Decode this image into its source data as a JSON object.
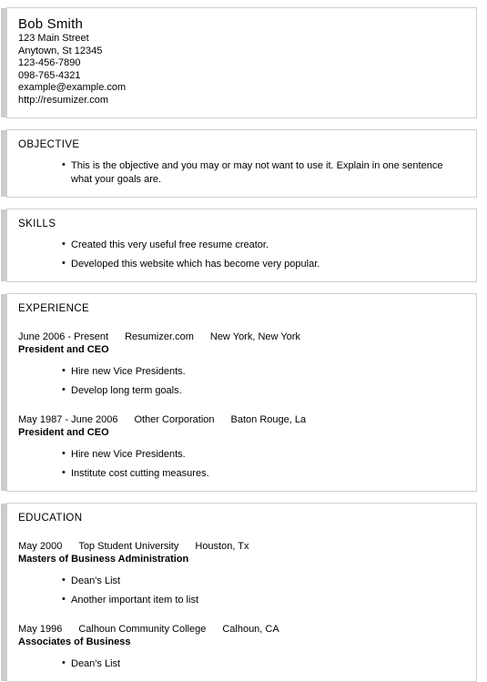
{
  "header": {
    "name": "Bob Smith",
    "contact_lines": [
      "123 Main Street",
      "Anytown, St 12345",
      "123-456-7890",
      "098-765-4321",
      "example@example.com",
      "http://resumizer.com"
    ]
  },
  "objective": {
    "heading": "OBJECTIVE",
    "bullets": [
      "This is the objective and you may or may not want to use it. Explain in one sentence what your goals are."
    ]
  },
  "skills": {
    "heading": "SKILLS",
    "bullets": [
      "Created this very useful free resume creator.",
      "Developed this website which has become very popular."
    ]
  },
  "experience": {
    "heading": "EXPERIENCE",
    "entries": [
      {
        "dates": "June 2006 - Present",
        "organization": "Resumizer.com",
        "location": "New York, New York",
        "title": "President and CEO",
        "bullets": [
          "Hire new Vice Presidents.",
          "Develop long term goals."
        ]
      },
      {
        "dates": "May 1987 - June 2006",
        "organization": "Other Corporation",
        "location": "Baton Rouge, La",
        "title": "President and CEO",
        "bullets": [
          "Hire new Vice Presidents.",
          "Institute cost cutting measures."
        ]
      }
    ]
  },
  "education": {
    "heading": "EDUCATION",
    "entries": [
      {
        "dates": "May 2000",
        "organization": "Top Student University",
        "location": "Houston, Tx",
        "title": "Masters of Business Administration",
        "bullets": [
          "Dean's List",
          "Another important item to list"
        ]
      },
      {
        "dates": "May 1996",
        "organization": "Calhoun Community College",
        "location": "Calhoun, CA",
        "title": "Associates of Business",
        "bullets": [
          "Dean's List"
        ]
      }
    ]
  },
  "colors": {
    "page_background": "#ffffff",
    "card_background": "#ffffff",
    "card_border": "#cfcfcf",
    "accent_bar": "#cccccc",
    "text": "#000000"
  }
}
